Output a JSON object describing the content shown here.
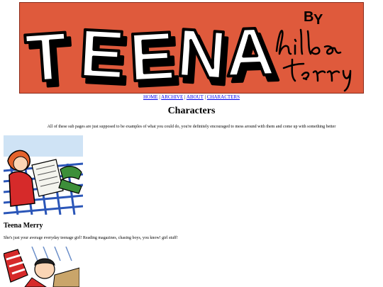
{
  "banner": {
    "logo_text": "TEENA",
    "by_text": "BY",
    "signature": "hilda terry"
  },
  "nav": {
    "items": [
      {
        "label": "HOME"
      },
      {
        "label": "ARCHIVE"
      },
      {
        "label": "ABOUT"
      },
      {
        "label": "CHARACTERS"
      }
    ],
    "separator": "|"
  },
  "page": {
    "title": "Characters",
    "intro": "All of these sub pages are just supposed to be examples of what you could do, you're definitely encouraged to mess around with them and come up with something better"
  },
  "characters": [
    {
      "name": "Teena Merry",
      "description": "She's just your average everyday teenage girl! Reading magazines, chasing boys, you know! girl stuff!"
    }
  ],
  "colors": {
    "banner_bg": "#df5a3c",
    "link": "#0000ee"
  }
}
